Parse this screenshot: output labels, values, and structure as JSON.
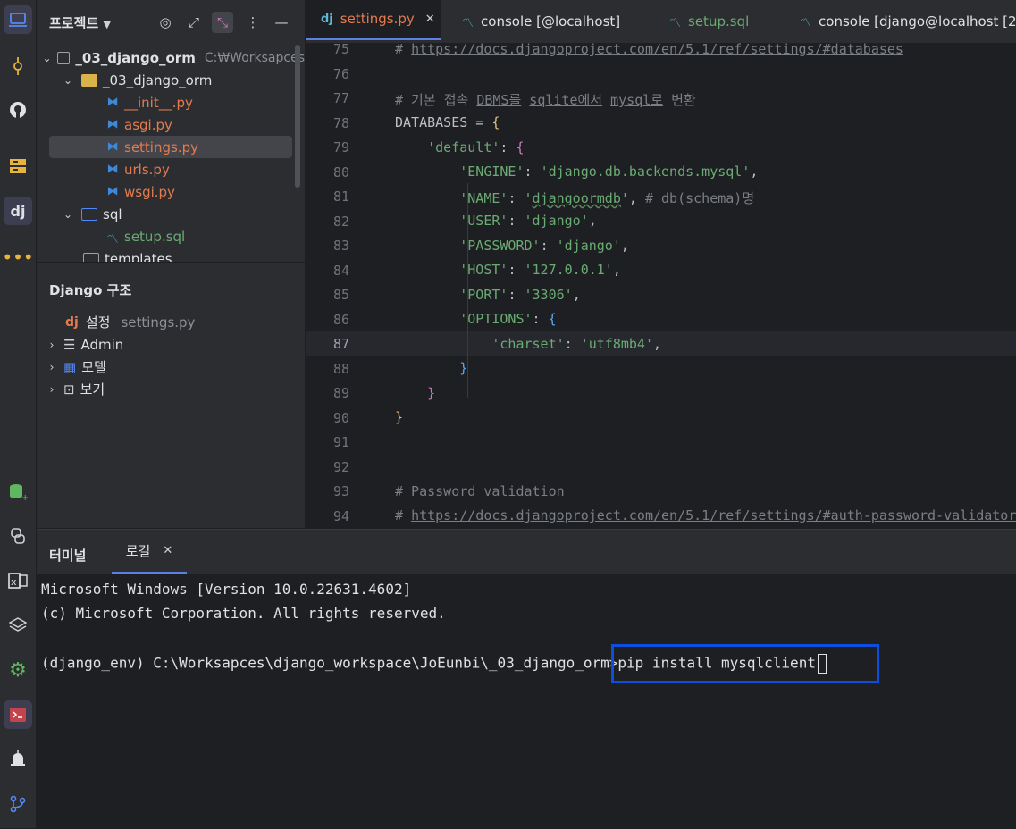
{
  "activity_bar": {
    "icons": [
      "project-icon",
      "commit-icon",
      "github-icon",
      "structure-icon",
      "django-icon",
      "more-icon",
      "database-add-icon",
      "python-icon",
      "excel-icon",
      "layers-icon",
      "settings-icon",
      "terminal-icon",
      "notifications-icon",
      "git-branch-icon"
    ]
  },
  "project": {
    "title": "프로젝트",
    "tree": [
      {
        "label": "_03_django_orm",
        "path": "C:₩Worksapces",
        "level": 0,
        "type": "folder-root"
      },
      {
        "label": "_03_django_orm",
        "level": 1,
        "type": "folder"
      },
      {
        "label": "__init__.py",
        "level": 2,
        "type": "py"
      },
      {
        "label": "asgi.py",
        "level": 2,
        "type": "py"
      },
      {
        "label": "settings.py",
        "level": 2,
        "type": "py",
        "selected": true
      },
      {
        "label": "urls.py",
        "level": 2,
        "type": "py"
      },
      {
        "label": "wsgi.py",
        "level": 2,
        "type": "py"
      },
      {
        "label": "sql",
        "level": 1,
        "type": "folder-sql"
      },
      {
        "label": "setup.sql",
        "level": 2,
        "type": "sql"
      },
      {
        "label": "templates",
        "level": 1,
        "type": "folder"
      }
    ]
  },
  "django_panel": {
    "title": "Django 구조",
    "settings_label": "설정",
    "settings_file": "settings.py",
    "items": [
      "Admin",
      "모델",
      "보기"
    ]
  },
  "tabs": [
    {
      "label": "settings.py",
      "active": true
    },
    {
      "label": "console [@localhost]"
    },
    {
      "label": "setup.sql"
    },
    {
      "label": "console [django@localhost [2"
    }
  ],
  "editor": {
    "line_numbers": [
      "75",
      "76",
      "77",
      "78",
      "79",
      "80",
      "81",
      "82",
      "83",
      "84",
      "85",
      "86",
      "87",
      "88",
      "89",
      "90",
      "91",
      "92",
      "93",
      "94"
    ]
  },
  "terminal": {
    "title": "터미널",
    "tab_local": "로컬",
    "lines": [
      "Microsoft Windows [Version 10.0.22631.4602]",
      "(c) Microsoft Corporation. All rights reserved.",
      "",
      "(django_env) C:\\Worksapces\\django_workspace\\JoEunbi\\_03_django_orm>pip install mysqlclient"
    ]
  },
  "colors": {
    "accent": "#5d7fdf",
    "highlight_box": "#0b4ee0",
    "string": "#6aab73",
    "comment": "#7a7e85"
  }
}
